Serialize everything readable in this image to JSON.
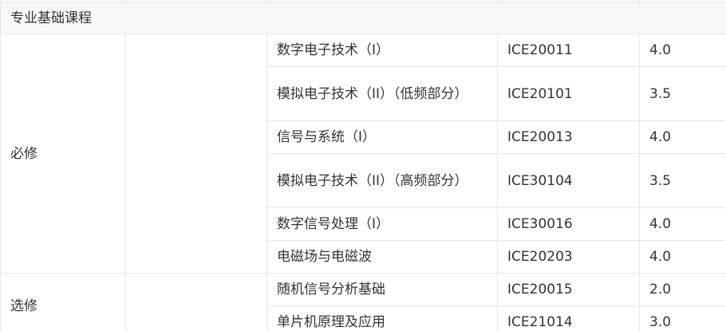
{
  "section_title": "专业基础课程",
  "groups": {
    "required": "必修",
    "elective": "选修"
  },
  "courses": [
    {
      "name": "数字电子技术（Ⅰ）",
      "code": "ICE20011",
      "credit": "4.0"
    },
    {
      "name": "模拟电子技术（II）（低频部分）",
      "code": "ICE20101",
      "credit": "3.5"
    },
    {
      "name": "信号与系统（Ⅰ）",
      "code": "ICE20013",
      "credit": "4.0"
    },
    {
      "name": "模拟电子技术（II）（高频部分）",
      "code": "ICE30104",
      "credit": "3.5"
    },
    {
      "name": "数字信号处理（Ⅰ）",
      "code": "ICE30016",
      "credit": "4.0"
    },
    {
      "name": "电磁场与电磁波",
      "code": "ICE20203",
      "credit": "4.0"
    },
    {
      "name": "随机信号分析基础",
      "code": "ICE20015",
      "credit": "2.0"
    },
    {
      "name": "单片机原理及应用",
      "code": "ICE21014",
      "credit": "3.0"
    }
  ]
}
